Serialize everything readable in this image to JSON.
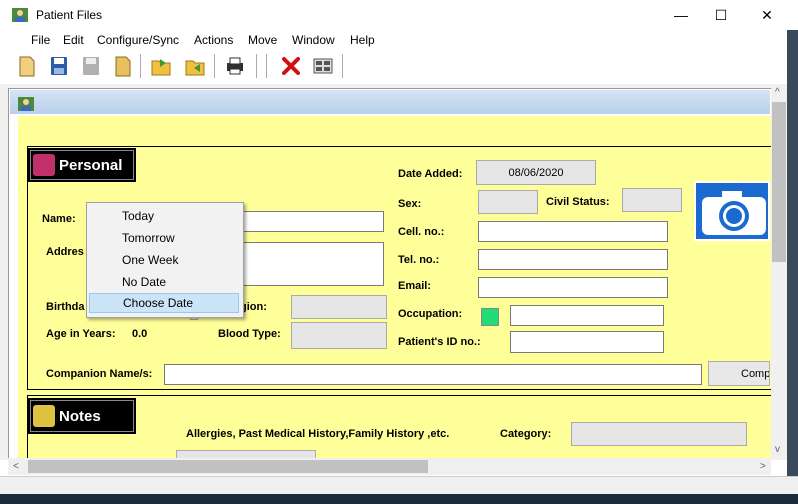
{
  "window": {
    "title": "Patient Files",
    "minimize": "—",
    "maximize": "☐",
    "close": "✕"
  },
  "menu": [
    "File",
    "Edit",
    "Configure/Sync",
    "Actions",
    "Move",
    "Window",
    "Help"
  ],
  "toolbar_icons": [
    "new-icon",
    "save-icon",
    "save-disabled-icon",
    "open-icon",
    "folder-export-icon",
    "folder-import-icon",
    "print-icon",
    "delete-icon",
    "grid-icon"
  ],
  "personal": {
    "header": "Personal",
    "name_label": "Name:",
    "address_label": "Addres",
    "birthday_label": "Birthda",
    "religion_label": "gion:",
    "age_label": "Age in Years:",
    "age_value": "0.0",
    "blood_type_label": "Blood Type:",
    "date_added_label": "Date Added:",
    "date_added_value": "08/06/2020",
    "sex_label": "Sex:",
    "civil_status_label": "Civil Status:",
    "cell_label": "Cell. no.:",
    "tel_label": "Tel. no.:",
    "email_label": "Email:",
    "occupation_label": "Occupation:",
    "patient_id_label": "Patient's ID no.:",
    "companion_label": "Companion Name/s:",
    "companion_button": "Compa"
  },
  "notes": {
    "header": "Notes",
    "history_label": "Allergies, Past Medical History,Family History ,etc.",
    "category_label": "Category:"
  },
  "date_popup": {
    "items": [
      "Today",
      "Tomorrow",
      "One Week",
      "No Date",
      "Choose Date"
    ],
    "selected": "Choose Date"
  },
  "scroll": {
    "up": "^",
    "down": "v",
    "left": "<",
    "right": ">"
  }
}
